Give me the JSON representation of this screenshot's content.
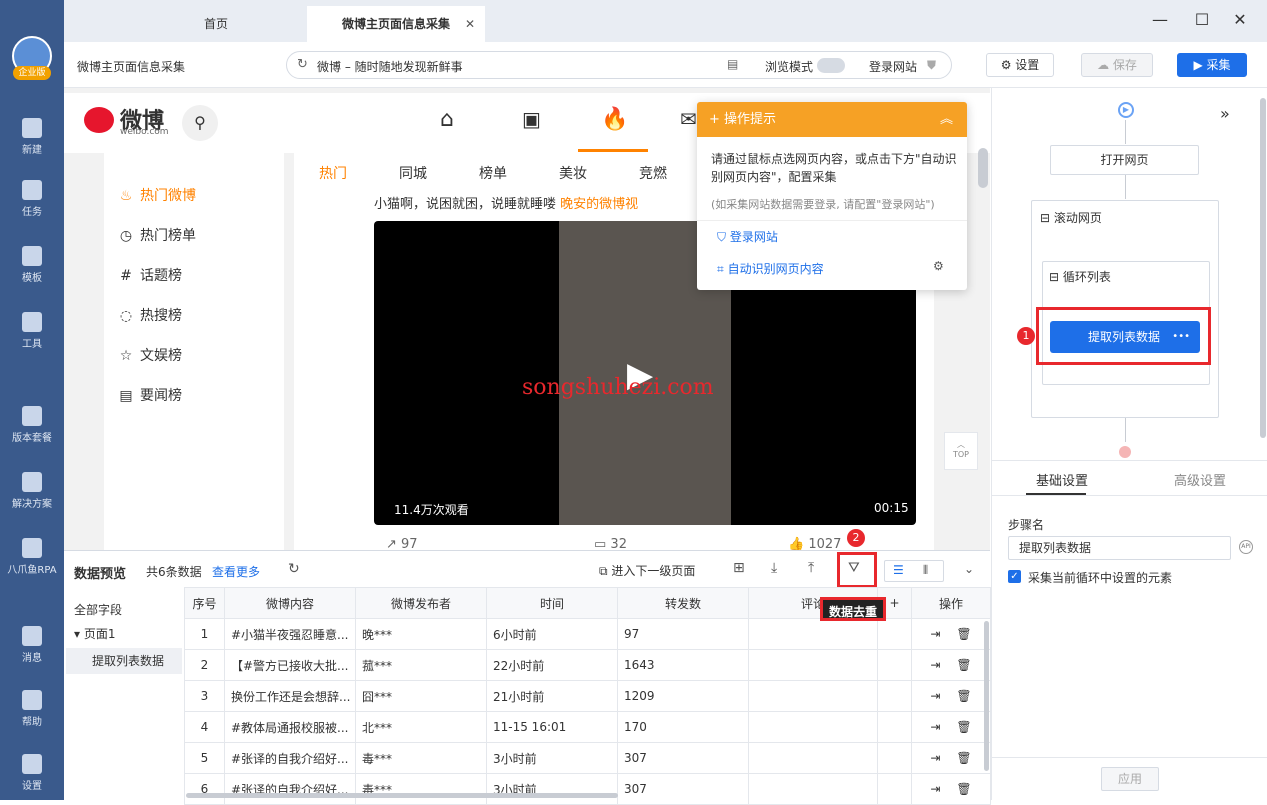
{
  "rail": {
    "badge": "企业版",
    "items": [
      {
        "label": "新建",
        "icon": "plus-icon"
      },
      {
        "label": "任务",
        "icon": "task-icon"
      },
      {
        "label": "模板",
        "icon": "template-icon"
      },
      {
        "label": "工具",
        "icon": "toolbox-icon"
      },
      {
        "label": "版本套餐",
        "icon": "crown-icon"
      },
      {
        "label": "解决方案",
        "icon": "solution-icon"
      },
      {
        "label": "八爪鱼RPA",
        "icon": "octopus-icon"
      },
      {
        "label": "消息",
        "icon": "bell-icon"
      },
      {
        "label": "帮助",
        "icon": "help-icon"
      },
      {
        "label": "设置",
        "icon": "gear-icon"
      }
    ]
  },
  "tabs": {
    "home": "首页",
    "active": "微博主页面信息采集",
    "close": "✕"
  },
  "window": {
    "min": "—",
    "max": "☐",
    "close": "✕"
  },
  "toolbar": {
    "task_title": "微博主页面信息采集",
    "address": "微博 – 随时随地发现新鲜事",
    "browse_mode": "浏览模式",
    "login_site": "登录网站",
    "settings": "设置",
    "save": "保存",
    "collect": "采集"
  },
  "weibo": {
    "logo_text": "微博",
    "logo_sub": "weibo.com",
    "side": [
      "热门微博",
      "热门榜单",
      "话题榜",
      "热搜榜",
      "文娱榜",
      "要闻榜"
    ],
    "subtabs": [
      "热门",
      "同城",
      "榜单",
      "美妆",
      "竞燃"
    ],
    "post_text": "小猫啊，说困就困，说睡就睡喽",
    "post_link": "晚安的微博视",
    "views": "11.4万次观看",
    "duration": "00:15",
    "watermark": "songshuhezi.com",
    "stats": [
      "97",
      "32",
      "1027"
    ],
    "top": "TOP"
  },
  "hint": {
    "title": "操作提示",
    "body": "请通过鼠标点选网页内容，或点击下方\"自动识别网页内容\"，配置采集",
    "note": "(如采集网站数据需要登录, 请配置\"登录网站\")",
    "login": "登录网站",
    "auto": "自动识别网页内容"
  },
  "flow": {
    "open": "打开网页",
    "scroll": "滚动网页",
    "loop": "循环列表",
    "extract": "提取列表数据",
    "more": "•••",
    "badge1": "1"
  },
  "settings": {
    "tab_basic": "基础设置",
    "tab_adv": "高级设置",
    "step_label": "步骤名",
    "step_value": "提取列表数据",
    "checkbox": "采集当前循环中设置的元素",
    "apply": "应用"
  },
  "preview": {
    "title": "数据预览",
    "count": "共6条数据",
    "more": "查看更多",
    "next_level": "进入下一级页面",
    "dedupe_tip": "数据去重",
    "badge2": "2",
    "tree_all": "全部字段",
    "tree_page": "页面1",
    "tree_step": "提取列表数据",
    "columns": [
      "序号",
      "微博内容",
      "微博发布者",
      "时间",
      "转发数",
      "评论",
      "",
      "操作"
    ],
    "rows": [
      [
        "1",
        "#小猫半夜强忍睡意...",
        "晚***",
        "6小时前",
        "97"
      ],
      [
        "2",
        "【#警方已接收大批...",
        "菰***",
        "22小时前",
        "1643"
      ],
      [
        "3",
        "换份工作还是会想辞...",
        "囧***",
        "21小时前",
        "1209"
      ],
      [
        "4",
        "#教体局通报校服被...",
        "北***",
        "11-15 16:01",
        "170"
      ],
      [
        "5",
        "#张译的自我介绍好...",
        "毒***",
        "3小时前",
        "307"
      ],
      [
        "6",
        "#张译的自我介绍好...",
        "毒***",
        "3小时前",
        "307"
      ]
    ]
  },
  "colors": {
    "rail": "#3a5a8c",
    "accent": "#1e6fe8",
    "orange": "#f6a125",
    "red": "#e8282d",
    "weibo_orange": "#ff8200"
  }
}
